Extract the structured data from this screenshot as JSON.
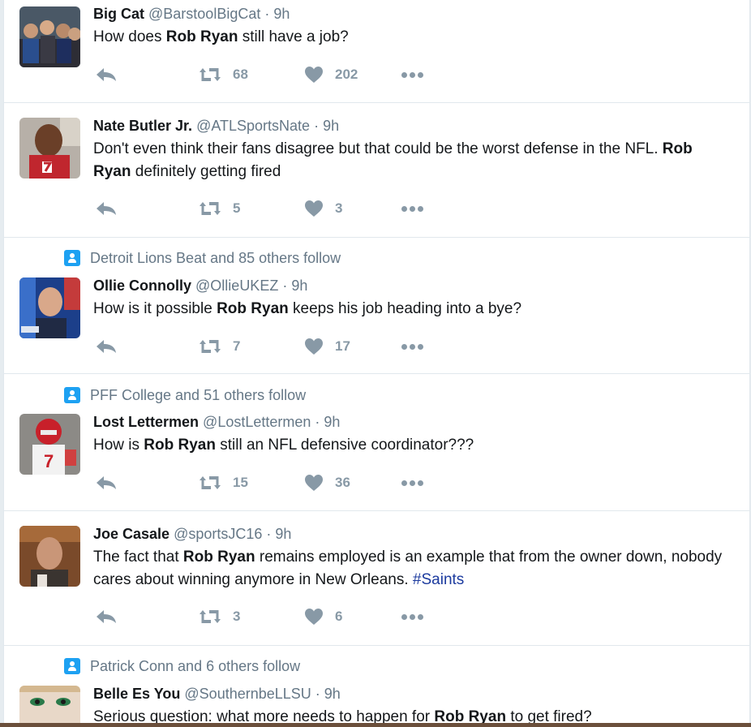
{
  "tweets": [
    {
      "context": "",
      "name": "Big Cat",
      "handle": "@BarstoolBigCat",
      "time": "· 9h",
      "text_parts": [
        [
          "How does ",
          false
        ],
        [
          "Rob Ryan",
          true
        ],
        [
          " still have a job?",
          false
        ]
      ],
      "retweets": "68",
      "likes": "202"
    },
    {
      "context": "",
      "name": "Nate Butler Jr.",
      "handle": "@ATLSportsNate",
      "time": "· 9h",
      "text_parts": [
        [
          "Don't even think their fans disagree but that could be the worst defense in the NFL. ",
          false
        ],
        [
          "Rob Ryan",
          true
        ],
        [
          " definitely getting fired",
          false
        ]
      ],
      "retweets": "5",
      "likes": "3"
    },
    {
      "context": "Detroit Lions Beat and 85 others follow",
      "name": "Ollie Connolly",
      "handle": "@OllieUKEZ",
      "time": "· 9h",
      "text_parts": [
        [
          "How is it possible ",
          false
        ],
        [
          "Rob Ryan",
          true
        ],
        [
          " keeps his job heading into a bye?",
          false
        ]
      ],
      "retweets": "7",
      "likes": "17"
    },
    {
      "context": "PFF College and 51 others follow",
      "name": "Lost Lettermen",
      "handle": "@LostLettermen",
      "time": "· 9h",
      "text_parts": [
        [
          "How is ",
          false
        ],
        [
          "Rob Ryan",
          true
        ],
        [
          " still an NFL defensive coordinator???",
          false
        ]
      ],
      "retweets": "15",
      "likes": "36"
    },
    {
      "context": "",
      "name": "Joe Casale",
      "handle": "@sportsJC16",
      "time": "· 9h",
      "text_parts": [
        [
          "The fact that ",
          false
        ],
        [
          "Rob Ryan",
          true
        ],
        [
          " remains employed is an example that from the owner down, nobody cares about winning anymore in New Orleans. ",
          false
        ],
        [
          "#Saints",
          "hashtag"
        ]
      ],
      "retweets": "3",
      "likes": "6"
    },
    {
      "context": "Patrick Conn and 6 others follow",
      "name": "Belle Es You",
      "handle": "@SouthernbeLLSU",
      "time": "· 9h",
      "text_parts": [
        [
          "Serious question: what more needs to happen for ",
          false
        ],
        [
          "Rob Ryan",
          true
        ],
        [
          " to get fired?",
          false
        ]
      ],
      "retweets": "",
      "likes": ""
    }
  ],
  "icons": {
    "reply": "reply-arrow-icon",
    "retweet": "retweet-icon",
    "like": "heart-icon",
    "more": "more-dots-icon",
    "context": "person-follow-icon"
  },
  "colors": {
    "secondary_text": "#657786",
    "action_gray": "#8899a6",
    "hashtag": "#1b3a9e",
    "context_icon": "#1da1f2"
  }
}
